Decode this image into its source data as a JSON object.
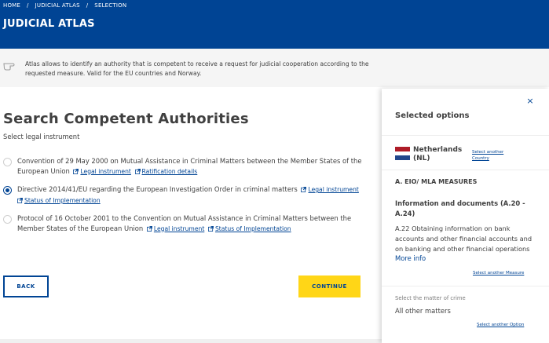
{
  "breadcrumb": [
    "HOME",
    "JUDICIAL ATLAS",
    "SELECTION"
  ],
  "breadcrumb_separator": "/",
  "header": {
    "title": "JUDICIAL ATLAS"
  },
  "info": {
    "icon": "pointing-hand-icon",
    "text": "Atlas allows to identify an authority that is competent to receive a request for judicial cooperation according to the requested measure. Valid for the EU countries and Norway."
  },
  "main": {
    "heading": "Search Competent Authorities",
    "subtitle": "Select legal instrument",
    "options": [
      {
        "text": "Convention of 29 May 2000 on Mutual Assistance in Criminal Matters between the Member States of the European Union",
        "links": [
          "Legal instrument",
          "Ratification details"
        ],
        "selected": false
      },
      {
        "text": "Directive 2014/41/EU regarding the European Investigation Order in criminal matters",
        "links": [
          "Legal instrument",
          "Status of Implementation"
        ],
        "selected": true
      },
      {
        "text": "Protocol of 16 October 2001 to the Convention on Mutual Assistance in Criminal Matters between the Member States of the European Union",
        "links": [
          "Legal instrument",
          "Status of Implementation"
        ],
        "selected": false
      }
    ],
    "back_label": "BACK",
    "continue_label": "CONTINUE"
  },
  "panel": {
    "close_symbol": "×",
    "title": "Selected options",
    "country": {
      "name": "Netherlands",
      "code": "(NL)",
      "flag_colors": [
        "#ae1c28",
        "#ffffff",
        "#21468b"
      ],
      "select_label": "Select another Country"
    },
    "section_heading": "A. EIO/ MLA MEASURES",
    "measure_title": "Information and documents (A.20 - A.24)",
    "measure_desc": "A.22 Obtaining information on bank accounts and other financial accounts and on banking and other financial operations",
    "more_info": "More info",
    "select_measure": "Select another Measure",
    "crime_label": "Select the matter of crime",
    "crime_value": "All other matters",
    "select_option": "Select another Option"
  },
  "colors": {
    "primary": "#004494",
    "accent": "#ffd617",
    "text": "#404040"
  }
}
